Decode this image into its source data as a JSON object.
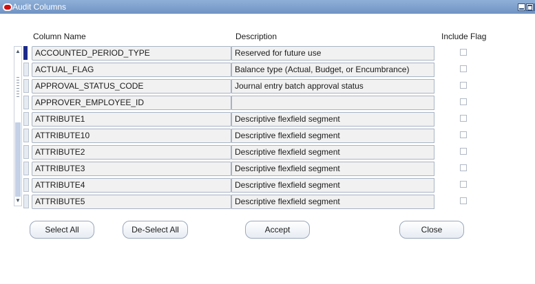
{
  "window": {
    "title": "Audit Columns"
  },
  "headers": {
    "column_name": "Column Name",
    "description": "Description",
    "include_flag": "Include Flag"
  },
  "rows": [
    {
      "name": "ACCOUNTED_PERIOD_TYPE",
      "description": "Reserved for future use",
      "include": false
    },
    {
      "name": "ACTUAL_FLAG",
      "description": "Balance type (Actual, Budget, or Encumbrance)",
      "include": false
    },
    {
      "name": "APPROVAL_STATUS_CODE",
      "description": "Journal entry batch approval status",
      "include": false
    },
    {
      "name": "APPROVER_EMPLOYEE_ID",
      "description": "",
      "include": false
    },
    {
      "name": "ATTRIBUTE1",
      "description": "Descriptive flexfield segment",
      "include": false
    },
    {
      "name": "ATTRIBUTE10",
      "description": "Descriptive flexfield segment",
      "include": false
    },
    {
      "name": "ATTRIBUTE2",
      "description": "Descriptive flexfield segment",
      "include": false
    },
    {
      "name": "ATTRIBUTE3",
      "description": "Descriptive flexfield segment",
      "include": false
    },
    {
      "name": "ATTRIBUTE4",
      "description": "Descriptive flexfield segment",
      "include": false
    },
    {
      "name": "ATTRIBUTE5",
      "description": "Descriptive flexfield segment",
      "include": false
    }
  ],
  "buttons": {
    "select_all": "Select All",
    "deselect_all": "De-Select All",
    "accept": "Accept",
    "close": "Close"
  },
  "icons": {
    "app_logo": "oracle-logo-icon",
    "minimize": "minimize-icon",
    "maximize": "maximize-icon"
  },
  "colors": {
    "titlebar": "#7a9ccc",
    "selected_row_indicator": "#1b2a8a",
    "cell_background": "#f1f1f1"
  }
}
